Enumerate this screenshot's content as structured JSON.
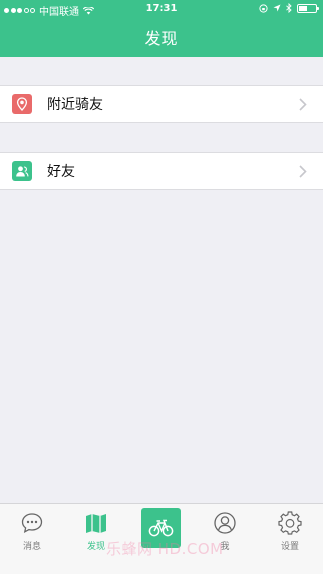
{
  "status_bar": {
    "carrier": "中国联通",
    "time": "17:31"
  },
  "nav": {
    "title": "发现"
  },
  "list": [
    {
      "label": "附近骑友",
      "icon": "location-pin-icon",
      "color": "#e96a6a"
    },
    {
      "label": "好友",
      "icon": "friends-icon",
      "color": "#3cc28c"
    }
  ],
  "tabbar": {
    "tabs": [
      {
        "label": "消息",
        "icon": "message-bubble-icon"
      },
      {
        "label": "发现",
        "icon": "map-icon",
        "active": true
      },
      {
        "label": "",
        "icon": "bicycle-icon"
      },
      {
        "label": "我",
        "icon": "profile-icon"
      },
      {
        "label": "设置",
        "icon": "gear-icon"
      }
    ]
  },
  "colors": {
    "accent": "#3cc28c",
    "background": "#efeff4",
    "nearby_icon": "#e96a6a"
  },
  "watermark": "乐蜂网 HD.COM"
}
